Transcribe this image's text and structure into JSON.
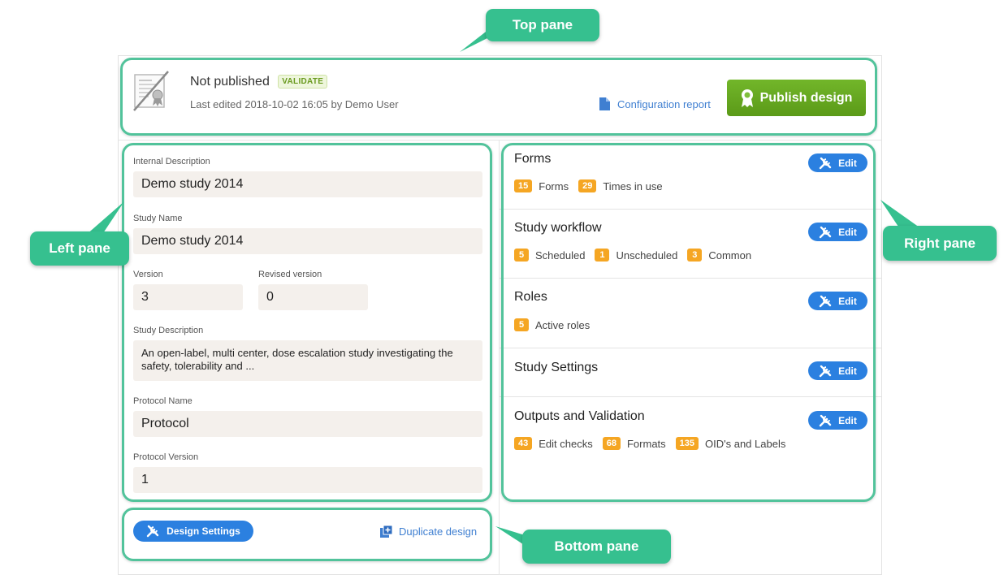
{
  "callouts": {
    "top_pane": "Top pane",
    "left_pane": "Left pane",
    "right_pane": "Right pane",
    "bottom_pane": "Bottom pane"
  },
  "colors": {
    "highlight": "#52c39b",
    "callout": "#36c08f",
    "publish_green": "#6aab22",
    "edit_blue": "#2b80e0",
    "count_orange": "#f5a623"
  },
  "header": {
    "status_title": "Not published",
    "validate_badge": "VALIDATE",
    "last_edited": "Last edited 2018-10-02 16:05 by Demo User",
    "config_report_link": "Configuration report",
    "publish_button": "Publish design",
    "icons": [
      "certificate-icon",
      "document-icon",
      "award-icon"
    ]
  },
  "left": {
    "internal_description": {
      "label": "Internal Description",
      "value": "Demo study 2014"
    },
    "study_name": {
      "label": "Study Name",
      "value": "Demo study 2014"
    },
    "version": {
      "label": "Version",
      "value": "3"
    },
    "revised_version": {
      "label": "Revised version",
      "value": "0"
    },
    "study_description": {
      "label": "Study Description",
      "value": "An open-label, multi center, dose escalation study investigating the safety, tolerability and ..."
    },
    "protocol_name": {
      "label": "Protocol Name",
      "value": "Protocol"
    },
    "protocol_version": {
      "label": "Protocol Version",
      "value": "1"
    }
  },
  "right": {
    "edit_label": "Edit",
    "sections": [
      {
        "title": "Forms",
        "stats": [
          {
            "count": "15",
            "label": "Forms"
          },
          {
            "count": "29",
            "label": "Times in use"
          }
        ]
      },
      {
        "title": "Study workflow",
        "stats": [
          {
            "count": "5",
            "label": "Scheduled"
          },
          {
            "count": "1",
            "label": "Unscheduled"
          },
          {
            "count": "3",
            "label": "Common"
          }
        ]
      },
      {
        "title": "Roles",
        "stats": [
          {
            "count": "5",
            "label": "Active roles"
          }
        ]
      },
      {
        "title": "Study Settings",
        "stats": []
      },
      {
        "title": "Outputs and Validation",
        "stats": [
          {
            "count": "43",
            "label": "Edit checks"
          },
          {
            "count": "68",
            "label": "Formats"
          },
          {
            "count": "135",
            "label": "OID's and Labels"
          }
        ]
      }
    ]
  },
  "bottom": {
    "design_settings_button": "Design Settings",
    "duplicate_link": "Duplicate design"
  }
}
